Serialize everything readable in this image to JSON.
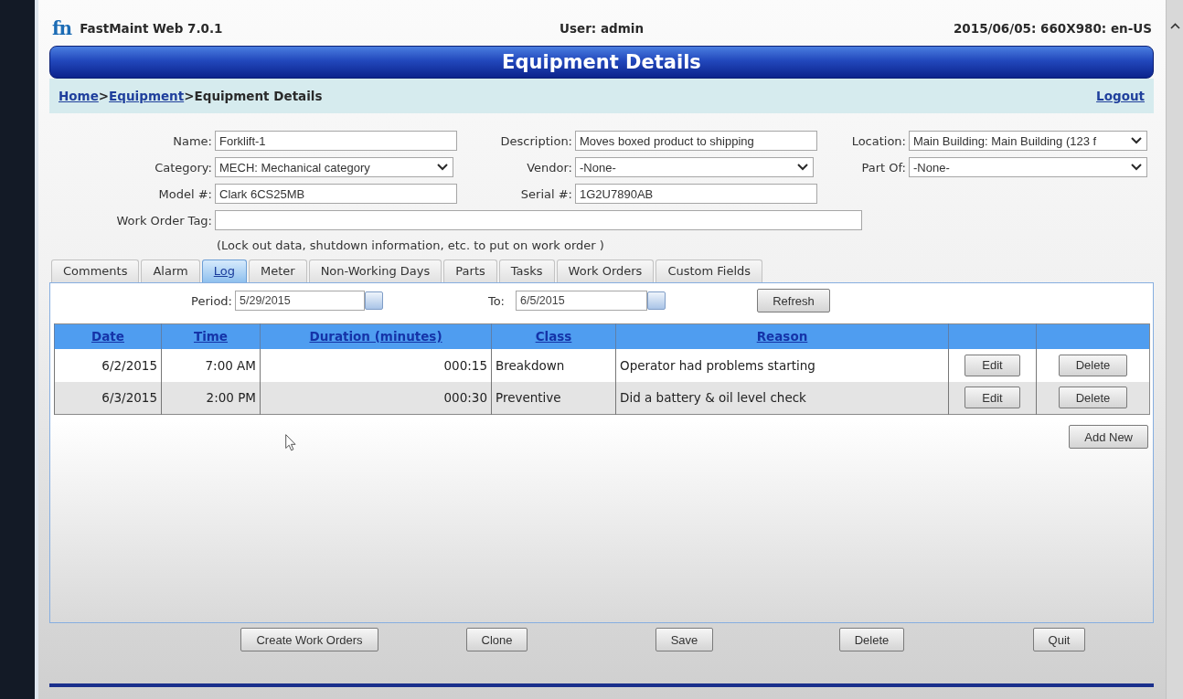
{
  "header": {
    "logo": "fn",
    "app_name": "FastMaint Web 7.0.1",
    "user": "User: admin",
    "session_info": "2015/06/05: 660X980: en-US"
  },
  "title": "Equipment Details",
  "breadcrumb": {
    "items": [
      {
        "kind": "link",
        "label": "Home"
      },
      {
        "kind": "separator",
        "label": ">"
      },
      {
        "kind": "link",
        "label": "Equipment"
      },
      {
        "kind": "separator",
        "label": ">"
      },
      {
        "kind": "current",
        "label": "Equipment Details"
      }
    ],
    "logout": "Logout"
  },
  "form": {
    "rows": [
      {
        "fields": [
          {
            "label": "Name:",
            "kind": "text",
            "value": "Forklift-1"
          },
          {
            "label": "Description:",
            "kind": "text",
            "value": "Moves boxed product to shipping"
          },
          {
            "label": "Location:",
            "kind": "select",
            "value": "Main Building: Main Building (123 f"
          }
        ]
      },
      {
        "fields": [
          {
            "label": "Category:",
            "kind": "select",
            "value": "MECH: Mechanical category"
          },
          {
            "label": "Vendor:",
            "kind": "select",
            "value": "-None-"
          },
          {
            "label": "Part Of:",
            "kind": "select",
            "value": "-None-"
          }
        ]
      },
      {
        "fields": [
          {
            "label": "Model #:",
            "kind": "text",
            "value": "Clark 6CS25MB"
          },
          {
            "label": "Serial #:",
            "kind": "text",
            "value": "1G2U7890AB"
          }
        ]
      },
      {
        "fields": [
          {
            "label": "Work Order Tag:",
            "kind": "wide_text"
          }
        ]
      }
    ],
    "note": "(Lock out data, shutdown information, etc. to put on work order )"
  },
  "tabs": [
    {
      "label": "Comments",
      "selected": false
    },
    {
      "label": "Alarm",
      "selected": false
    },
    {
      "label": "Log",
      "selected": true
    },
    {
      "label": "Meter",
      "selected": false
    },
    {
      "label": "Non-Working Days",
      "selected": false
    },
    {
      "label": "Parts",
      "selected": false
    },
    {
      "label": "Tasks",
      "selected": false
    },
    {
      "label": "Work Orders",
      "selected": false
    },
    {
      "label": "Custom Fields",
      "selected": false
    }
  ],
  "log_filter": {
    "fields": [
      {
        "label": "Period:",
        "value": "5/29/2015"
      },
      {
        "label": "To:",
        "value": "6/5/2015"
      }
    ],
    "button": "Refresh"
  },
  "table": {
    "columns": [
      "Date",
      "Time",
      "Duration (minutes)",
      "Class",
      "Reason"
    ],
    "rows": [
      {
        "cells": [
          "6/2/2015",
          "7:00 AM",
          "000:15",
          "Breakdown",
          "Operator had problems starting"
        ],
        "actions": [
          "Edit",
          "Delete"
        ]
      },
      {
        "cells": [
          "6/3/2015",
          "2:00 PM",
          "000:30",
          "Preventive",
          "Did a battery & oil level check"
        ],
        "actions": [
          "Edit",
          "Delete"
        ]
      }
    ]
  },
  "add_button": "Add New",
  "footer_buttons": [
    "Create Work Orders",
    "Clone",
    "Save",
    "Delete",
    "Quit"
  ]
}
